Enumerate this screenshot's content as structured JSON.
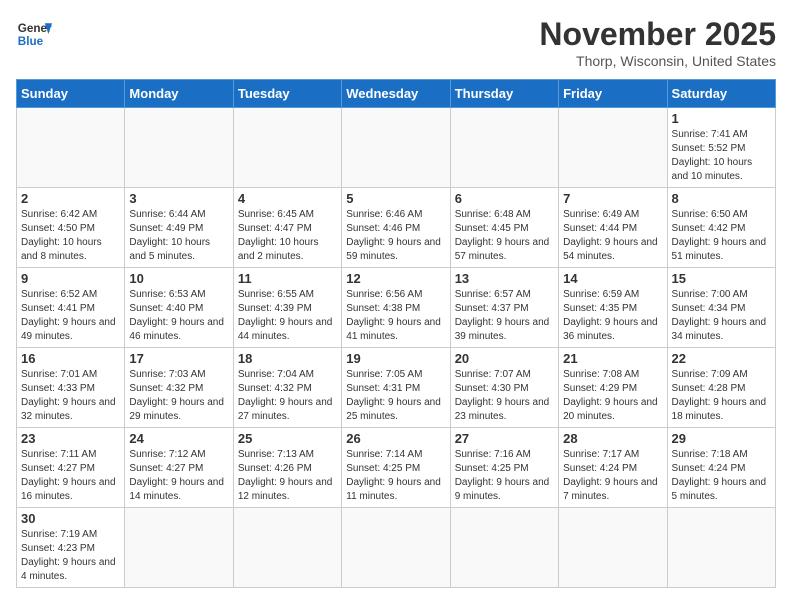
{
  "header": {
    "logo_text_general": "General",
    "logo_text_blue": "Blue",
    "month_title": "November 2025",
    "location": "Thorp, Wisconsin, United States"
  },
  "weekdays": [
    "Sunday",
    "Monday",
    "Tuesday",
    "Wednesday",
    "Thursday",
    "Friday",
    "Saturday"
  ],
  "weeks": [
    [
      {
        "day": "",
        "info": ""
      },
      {
        "day": "",
        "info": ""
      },
      {
        "day": "",
        "info": ""
      },
      {
        "day": "",
        "info": ""
      },
      {
        "day": "",
        "info": ""
      },
      {
        "day": "",
        "info": ""
      },
      {
        "day": "1",
        "info": "Sunrise: 7:41 AM\nSunset: 5:52 PM\nDaylight: 10 hours and 10 minutes."
      }
    ],
    [
      {
        "day": "2",
        "info": "Sunrise: 6:42 AM\nSunset: 4:50 PM\nDaylight: 10 hours and 8 minutes."
      },
      {
        "day": "3",
        "info": "Sunrise: 6:44 AM\nSunset: 4:49 PM\nDaylight: 10 hours and 5 minutes."
      },
      {
        "day": "4",
        "info": "Sunrise: 6:45 AM\nSunset: 4:47 PM\nDaylight: 10 hours and 2 minutes."
      },
      {
        "day": "5",
        "info": "Sunrise: 6:46 AM\nSunset: 4:46 PM\nDaylight: 9 hours and 59 minutes."
      },
      {
        "day": "6",
        "info": "Sunrise: 6:48 AM\nSunset: 4:45 PM\nDaylight: 9 hours and 57 minutes."
      },
      {
        "day": "7",
        "info": "Sunrise: 6:49 AM\nSunset: 4:44 PM\nDaylight: 9 hours and 54 minutes."
      },
      {
        "day": "8",
        "info": "Sunrise: 6:50 AM\nSunset: 4:42 PM\nDaylight: 9 hours and 51 minutes."
      }
    ],
    [
      {
        "day": "9",
        "info": "Sunrise: 6:52 AM\nSunset: 4:41 PM\nDaylight: 9 hours and 49 minutes."
      },
      {
        "day": "10",
        "info": "Sunrise: 6:53 AM\nSunset: 4:40 PM\nDaylight: 9 hours and 46 minutes."
      },
      {
        "day": "11",
        "info": "Sunrise: 6:55 AM\nSunset: 4:39 PM\nDaylight: 9 hours and 44 minutes."
      },
      {
        "day": "12",
        "info": "Sunrise: 6:56 AM\nSunset: 4:38 PM\nDaylight: 9 hours and 41 minutes."
      },
      {
        "day": "13",
        "info": "Sunrise: 6:57 AM\nSunset: 4:37 PM\nDaylight: 9 hours and 39 minutes."
      },
      {
        "day": "14",
        "info": "Sunrise: 6:59 AM\nSunset: 4:35 PM\nDaylight: 9 hours and 36 minutes."
      },
      {
        "day": "15",
        "info": "Sunrise: 7:00 AM\nSunset: 4:34 PM\nDaylight: 9 hours and 34 minutes."
      }
    ],
    [
      {
        "day": "16",
        "info": "Sunrise: 7:01 AM\nSunset: 4:33 PM\nDaylight: 9 hours and 32 minutes."
      },
      {
        "day": "17",
        "info": "Sunrise: 7:03 AM\nSunset: 4:32 PM\nDaylight: 9 hours and 29 minutes."
      },
      {
        "day": "18",
        "info": "Sunrise: 7:04 AM\nSunset: 4:32 PM\nDaylight: 9 hours and 27 minutes."
      },
      {
        "day": "19",
        "info": "Sunrise: 7:05 AM\nSunset: 4:31 PM\nDaylight: 9 hours and 25 minutes."
      },
      {
        "day": "20",
        "info": "Sunrise: 7:07 AM\nSunset: 4:30 PM\nDaylight: 9 hours and 23 minutes."
      },
      {
        "day": "21",
        "info": "Sunrise: 7:08 AM\nSunset: 4:29 PM\nDaylight: 9 hours and 20 minutes."
      },
      {
        "day": "22",
        "info": "Sunrise: 7:09 AM\nSunset: 4:28 PM\nDaylight: 9 hours and 18 minutes."
      }
    ],
    [
      {
        "day": "23",
        "info": "Sunrise: 7:11 AM\nSunset: 4:27 PM\nDaylight: 9 hours and 16 minutes."
      },
      {
        "day": "24",
        "info": "Sunrise: 7:12 AM\nSunset: 4:27 PM\nDaylight: 9 hours and 14 minutes."
      },
      {
        "day": "25",
        "info": "Sunrise: 7:13 AM\nSunset: 4:26 PM\nDaylight: 9 hours and 12 minutes."
      },
      {
        "day": "26",
        "info": "Sunrise: 7:14 AM\nSunset: 4:25 PM\nDaylight: 9 hours and 11 minutes."
      },
      {
        "day": "27",
        "info": "Sunrise: 7:16 AM\nSunset: 4:25 PM\nDaylight: 9 hours and 9 minutes."
      },
      {
        "day": "28",
        "info": "Sunrise: 7:17 AM\nSunset: 4:24 PM\nDaylight: 9 hours and 7 minutes."
      },
      {
        "day": "29",
        "info": "Sunrise: 7:18 AM\nSunset: 4:24 PM\nDaylight: 9 hours and 5 minutes."
      }
    ],
    [
      {
        "day": "30",
        "info": "Sunrise: 7:19 AM\nSunset: 4:23 PM\nDaylight: 9 hours and 4 minutes."
      },
      {
        "day": "",
        "info": ""
      },
      {
        "day": "",
        "info": ""
      },
      {
        "day": "",
        "info": ""
      },
      {
        "day": "",
        "info": ""
      },
      {
        "day": "",
        "info": ""
      },
      {
        "day": "",
        "info": ""
      }
    ]
  ]
}
